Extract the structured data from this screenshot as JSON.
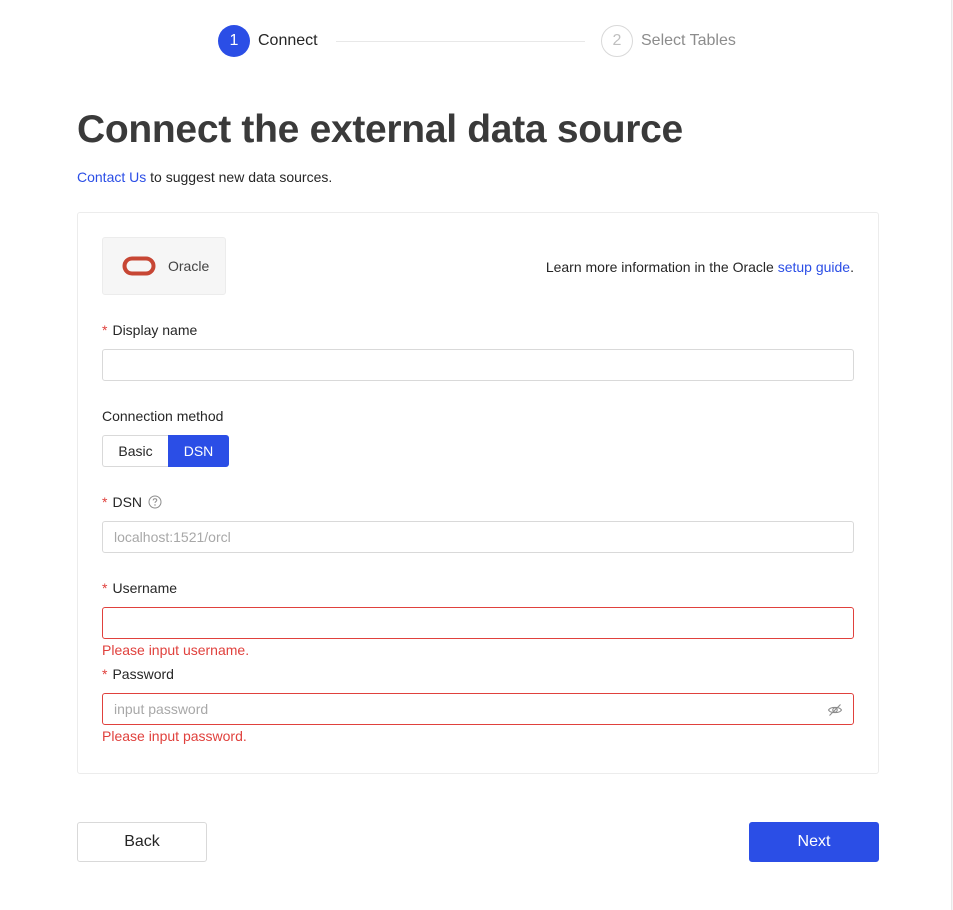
{
  "steps": [
    {
      "number": "1",
      "title": "Connect"
    },
    {
      "number": "2",
      "title": "Select Tables"
    }
  ],
  "heading": "Connect the external data source",
  "subtitle": {
    "link": "Contact Us",
    "text": " to suggest new data sources."
  },
  "source": {
    "name": "Oracle",
    "icon": "oracle-logo-icon",
    "learn_prefix": "Learn more information in the Oracle ",
    "learn_link": "setup guide",
    "learn_suffix": "."
  },
  "form": {
    "required_mark": "*",
    "display_name": {
      "label": "Display name",
      "value": ""
    },
    "connection_method": {
      "label": "Connection method",
      "options": [
        "Basic",
        "DSN"
      ],
      "selected": "DSN"
    },
    "dsn": {
      "label": "DSN",
      "placeholder": "localhost:1521/orcl",
      "help_icon": "question-circle-icon"
    },
    "username": {
      "label": "Username",
      "value": "",
      "error": "Please input username."
    },
    "password": {
      "label": "Password",
      "placeholder": "input password",
      "error": "Please input password.",
      "toggle_icon": "eye-invisible-icon"
    }
  },
  "buttons": {
    "back": "Back",
    "next": "Next"
  },
  "colors": {
    "primary": "#2b4ee6",
    "error": "#e0413d",
    "oracle": "#c74634"
  }
}
